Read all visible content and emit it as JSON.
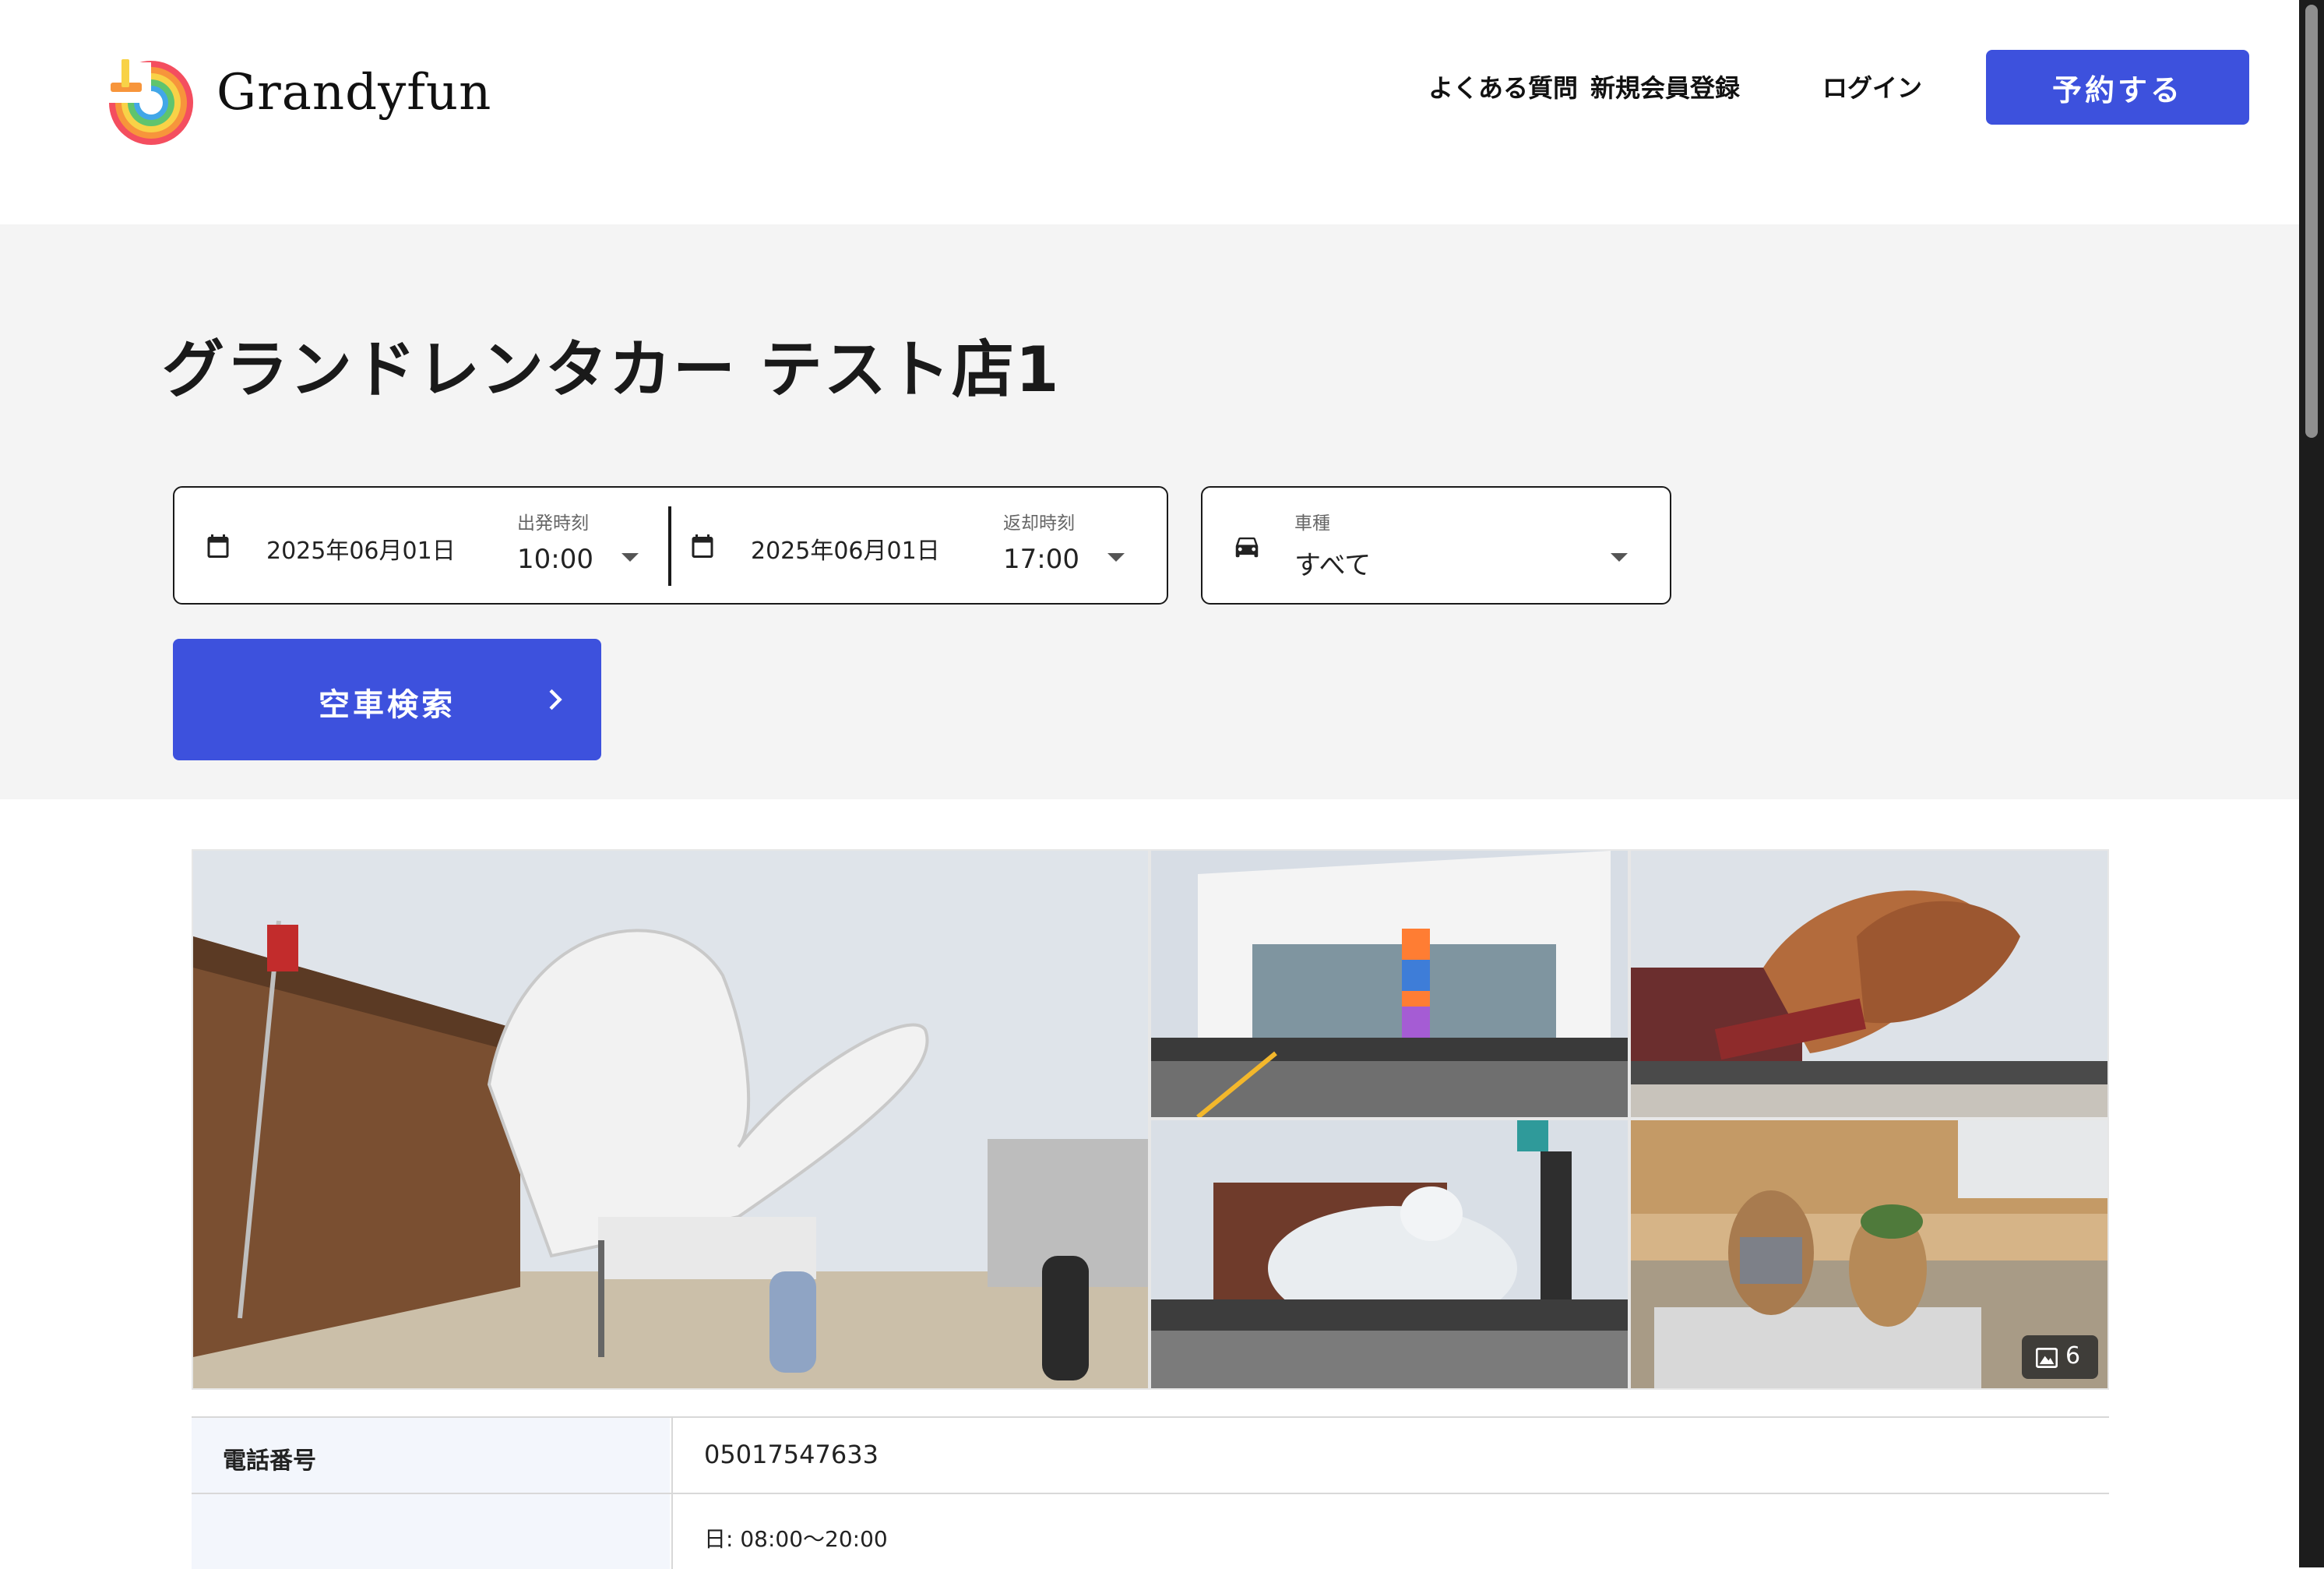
{
  "header": {
    "brand_name": "Grandyfun",
    "nav": {
      "faq": "よくある質問",
      "signup": "新規会員登録",
      "login": "ログイン"
    },
    "reserve_label": "予約する"
  },
  "search": {
    "shop_title": "グランドレンタカー テスト店1",
    "departure": {
      "date": "2025年06月01日",
      "time_label": "出発時刻",
      "time": "10:00"
    },
    "return": {
      "date": "2025年06月01日",
      "time_label": "返却時刻",
      "time": "17:00"
    },
    "car_type": {
      "label": "車種",
      "value": "すべて"
    },
    "submit_label": "空車検索"
  },
  "gallery": {
    "photo_count": "6"
  },
  "info": {
    "phone_label": "電話番号",
    "phone_value": "05017547633",
    "hours_sunday": "日: 08:00〜20:00"
  },
  "colors": {
    "primary": "#3d51dd",
    "section_bg": "#f4f4f4",
    "table_label_bg": "#f3f6fc"
  },
  "icons": [
    "calendar-icon",
    "car-icon",
    "chevron-down-icon",
    "chevron-right-icon",
    "image-icon"
  ]
}
